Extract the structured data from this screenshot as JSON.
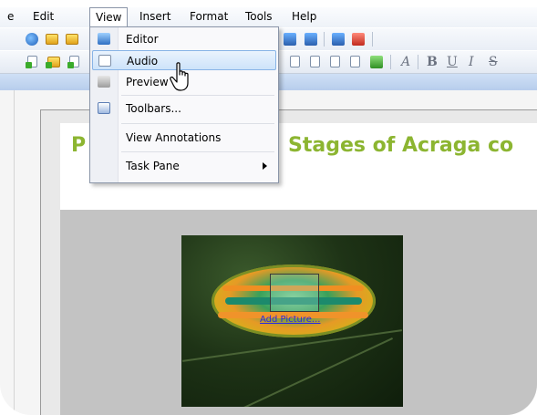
{
  "menubar": {
    "partial": "e",
    "items": [
      "Edit",
      "View",
      "Insert",
      "Format",
      "Tools",
      "Help"
    ],
    "open_item": "View"
  },
  "view_menu": {
    "items": [
      {
        "label": "Editor",
        "icon": "editor-icon"
      },
      {
        "label": "Audio",
        "icon": "audio-icon",
        "highlighted": true
      },
      {
        "label": "Preview",
        "icon": "preview-icon"
      },
      {
        "label": "Toolbars...",
        "icon": "toolbars-icon"
      },
      {
        "label": "View Annotations"
      },
      {
        "label": "Task Pane",
        "submenu": true
      }
    ]
  },
  "format_toolbar": {
    "a": "A",
    "b": "B",
    "u": "U",
    "i": "I",
    "s": "S"
  },
  "slide": {
    "title_left": "P",
    "title_right": "Stages of Acraga co",
    "title_color": "#8cb531",
    "picture_link": "Add Picture..."
  },
  "colors": {
    "accent_blue": "#b7cdec",
    "highlight": "#cde3fa"
  }
}
